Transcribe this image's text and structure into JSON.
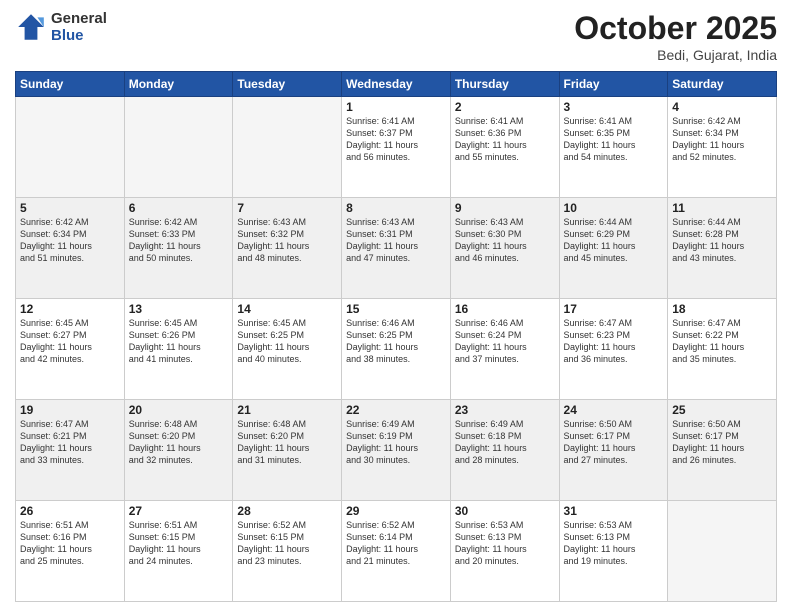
{
  "header": {
    "logo_line1": "General",
    "logo_line2": "Blue",
    "month_year": "October 2025",
    "location": "Bedi, Gujarat, India"
  },
  "weekdays": [
    "Sunday",
    "Monday",
    "Tuesday",
    "Wednesday",
    "Thursday",
    "Friday",
    "Saturday"
  ],
  "weeks": [
    {
      "shaded": false,
      "days": [
        {
          "number": "",
          "info": ""
        },
        {
          "number": "",
          "info": ""
        },
        {
          "number": "",
          "info": ""
        },
        {
          "number": "1",
          "info": "Sunrise: 6:41 AM\nSunset: 6:37 PM\nDaylight: 11 hours\nand 56 minutes."
        },
        {
          "number": "2",
          "info": "Sunrise: 6:41 AM\nSunset: 6:36 PM\nDaylight: 11 hours\nand 55 minutes."
        },
        {
          "number": "3",
          "info": "Sunrise: 6:41 AM\nSunset: 6:35 PM\nDaylight: 11 hours\nand 54 minutes."
        },
        {
          "number": "4",
          "info": "Sunrise: 6:42 AM\nSunset: 6:34 PM\nDaylight: 11 hours\nand 52 minutes."
        }
      ]
    },
    {
      "shaded": true,
      "days": [
        {
          "number": "5",
          "info": "Sunrise: 6:42 AM\nSunset: 6:34 PM\nDaylight: 11 hours\nand 51 minutes."
        },
        {
          "number": "6",
          "info": "Sunrise: 6:42 AM\nSunset: 6:33 PM\nDaylight: 11 hours\nand 50 minutes."
        },
        {
          "number": "7",
          "info": "Sunrise: 6:43 AM\nSunset: 6:32 PM\nDaylight: 11 hours\nand 48 minutes."
        },
        {
          "number": "8",
          "info": "Sunrise: 6:43 AM\nSunset: 6:31 PM\nDaylight: 11 hours\nand 47 minutes."
        },
        {
          "number": "9",
          "info": "Sunrise: 6:43 AM\nSunset: 6:30 PM\nDaylight: 11 hours\nand 46 minutes."
        },
        {
          "number": "10",
          "info": "Sunrise: 6:44 AM\nSunset: 6:29 PM\nDaylight: 11 hours\nand 45 minutes."
        },
        {
          "number": "11",
          "info": "Sunrise: 6:44 AM\nSunset: 6:28 PM\nDaylight: 11 hours\nand 43 minutes."
        }
      ]
    },
    {
      "shaded": false,
      "days": [
        {
          "number": "12",
          "info": "Sunrise: 6:45 AM\nSunset: 6:27 PM\nDaylight: 11 hours\nand 42 minutes."
        },
        {
          "number": "13",
          "info": "Sunrise: 6:45 AM\nSunset: 6:26 PM\nDaylight: 11 hours\nand 41 minutes."
        },
        {
          "number": "14",
          "info": "Sunrise: 6:45 AM\nSunset: 6:25 PM\nDaylight: 11 hours\nand 40 minutes."
        },
        {
          "number": "15",
          "info": "Sunrise: 6:46 AM\nSunset: 6:25 PM\nDaylight: 11 hours\nand 38 minutes."
        },
        {
          "number": "16",
          "info": "Sunrise: 6:46 AM\nSunset: 6:24 PM\nDaylight: 11 hours\nand 37 minutes."
        },
        {
          "number": "17",
          "info": "Sunrise: 6:47 AM\nSunset: 6:23 PM\nDaylight: 11 hours\nand 36 minutes."
        },
        {
          "number": "18",
          "info": "Sunrise: 6:47 AM\nSunset: 6:22 PM\nDaylight: 11 hours\nand 35 minutes."
        }
      ]
    },
    {
      "shaded": true,
      "days": [
        {
          "number": "19",
          "info": "Sunrise: 6:47 AM\nSunset: 6:21 PM\nDaylight: 11 hours\nand 33 minutes."
        },
        {
          "number": "20",
          "info": "Sunrise: 6:48 AM\nSunset: 6:20 PM\nDaylight: 11 hours\nand 32 minutes."
        },
        {
          "number": "21",
          "info": "Sunrise: 6:48 AM\nSunset: 6:20 PM\nDaylight: 11 hours\nand 31 minutes."
        },
        {
          "number": "22",
          "info": "Sunrise: 6:49 AM\nSunset: 6:19 PM\nDaylight: 11 hours\nand 30 minutes."
        },
        {
          "number": "23",
          "info": "Sunrise: 6:49 AM\nSunset: 6:18 PM\nDaylight: 11 hours\nand 28 minutes."
        },
        {
          "number": "24",
          "info": "Sunrise: 6:50 AM\nSunset: 6:17 PM\nDaylight: 11 hours\nand 27 minutes."
        },
        {
          "number": "25",
          "info": "Sunrise: 6:50 AM\nSunset: 6:17 PM\nDaylight: 11 hours\nand 26 minutes."
        }
      ]
    },
    {
      "shaded": false,
      "days": [
        {
          "number": "26",
          "info": "Sunrise: 6:51 AM\nSunset: 6:16 PM\nDaylight: 11 hours\nand 25 minutes."
        },
        {
          "number": "27",
          "info": "Sunrise: 6:51 AM\nSunset: 6:15 PM\nDaylight: 11 hours\nand 24 minutes."
        },
        {
          "number": "28",
          "info": "Sunrise: 6:52 AM\nSunset: 6:15 PM\nDaylight: 11 hours\nand 23 minutes."
        },
        {
          "number": "29",
          "info": "Sunrise: 6:52 AM\nSunset: 6:14 PM\nDaylight: 11 hours\nand 21 minutes."
        },
        {
          "number": "30",
          "info": "Sunrise: 6:53 AM\nSunset: 6:13 PM\nDaylight: 11 hours\nand 20 minutes."
        },
        {
          "number": "31",
          "info": "Sunrise: 6:53 AM\nSunset: 6:13 PM\nDaylight: 11 hours\nand 19 minutes."
        },
        {
          "number": "",
          "info": ""
        }
      ]
    }
  ]
}
